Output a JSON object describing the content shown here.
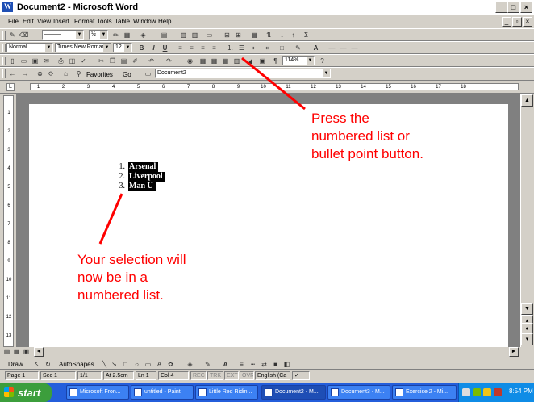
{
  "window": {
    "title": "Document2 - Microsoft Word",
    "app_icon_letter": "W",
    "controls": {
      "minimize": "_",
      "maximize": "□",
      "close": "×"
    }
  },
  "menu": {
    "items": [
      "File",
      "Edit",
      "View",
      "Insert",
      "Format",
      "Tools",
      "Table",
      "Window",
      "Help"
    ],
    "doc_controls": {
      "minimize": "_",
      "restore": "▫",
      "close": "×"
    }
  },
  "toolbar_draw_table": {
    "line_weight": "½",
    "line_style": "———"
  },
  "toolbar_formatting": {
    "style": "Normal",
    "font": "Times New Roman",
    "size": "12"
  },
  "toolbar_standard": {
    "zoom": "114%"
  },
  "toolbar_web": {
    "favorites": "Favorites",
    "go": "Go",
    "address": "Document2"
  },
  "ruler": {
    "ticks": [
      "1",
      "2",
      "3",
      "4",
      "5",
      "6",
      "7",
      "8",
      "9",
      "10",
      "11",
      "12",
      "13",
      "14",
      "15",
      "16",
      "17",
      "18"
    ],
    "vticks": [
      "1",
      "2",
      "3",
      "4",
      "5",
      "6",
      "7",
      "8",
      "9",
      "10",
      "11",
      "12",
      "13"
    ]
  },
  "document": {
    "list": [
      {
        "num": "1.",
        "text": "Arsenal"
      },
      {
        "num": "2.",
        "text": "Liverpool"
      },
      {
        "num": "3.",
        "text": "Man U"
      }
    ]
  },
  "annotations": {
    "top": [
      "Press the",
      "numbered list or",
      "bullet point button."
    ],
    "bottom": [
      "Your selection will",
      "now be in a",
      "numbered list."
    ],
    "color": "#ff0000"
  },
  "drawing_toolbar": {
    "draw": "Draw",
    "autoshapes": "AutoShapes"
  },
  "status": {
    "page": "Page 1",
    "sec": "Sec 1",
    "pages": "1/1",
    "at": "At 2.5cm",
    "ln": "Ln 1",
    "col": "Col 4",
    "rec": "REC",
    "trk": "TRK",
    "ext": "EXT",
    "ovr": "OVR",
    "lang": "English (Ca"
  },
  "taskbar": {
    "start": "start",
    "buttons": [
      {
        "label": "Microsoft Fron...",
        "active": false
      },
      {
        "label": "untitled - Paint",
        "active": false
      },
      {
        "label": "Little Red Ridin...",
        "active": false
      },
      {
        "label": "Document2 - M...",
        "active": true
      },
      {
        "label": "Document3 - M...",
        "active": false
      },
      {
        "label": "Exercise 2 - Mi...",
        "active": false
      }
    ],
    "clock": "8:54 PM"
  }
}
